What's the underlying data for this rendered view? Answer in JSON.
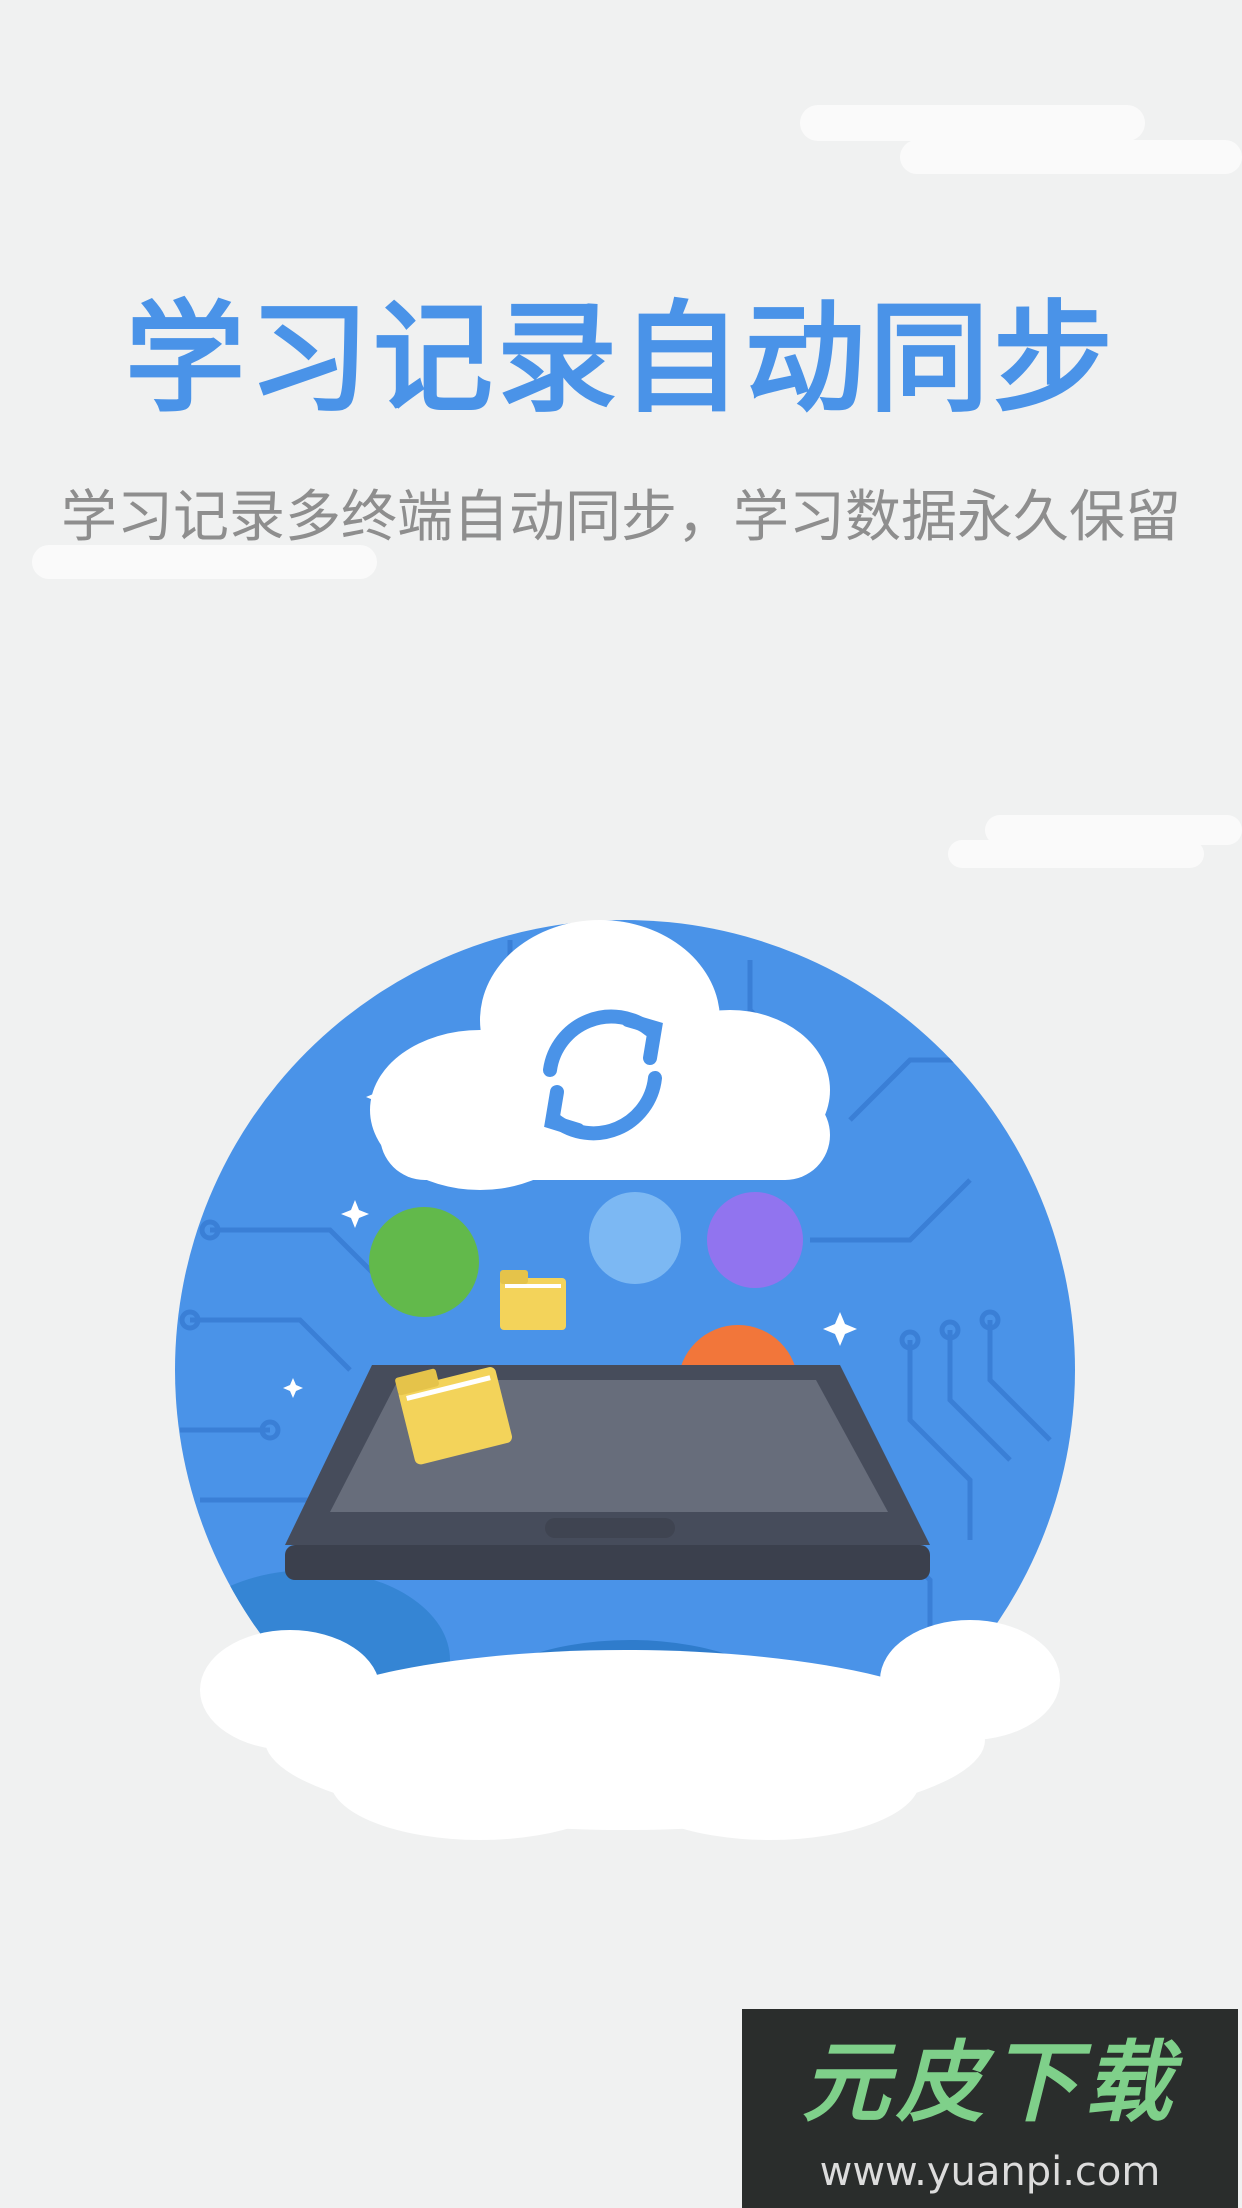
{
  "headline": "学习记录自动同步",
  "subtitle": "学习记录多终端自动同步，学习数据永久保留",
  "watermark": {
    "logo": "元皮下载",
    "url": "www.yuanpi.com"
  },
  "colors": {
    "accent": "#4a93e8",
    "background": "#f0f1f1",
    "subtitle": "#8e8e8e"
  },
  "illustration": {
    "icons": [
      "cloud-icon",
      "sync-icon",
      "tablet-icon",
      "folder-icon",
      "sparkle-icon"
    ],
    "dots": [
      "#62b94b",
      "#7cb8f3",
      "#9174ef",
      "#f2763a"
    ]
  }
}
